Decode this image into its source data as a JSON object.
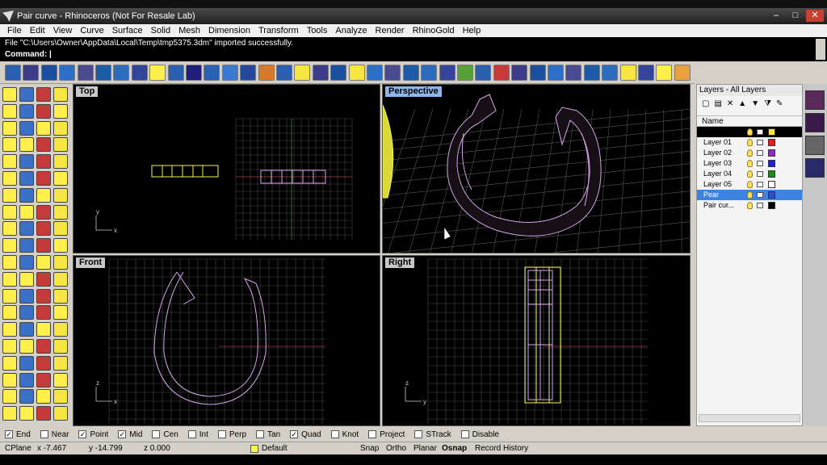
{
  "window": {
    "title": "Pair curve - Rhinoceros (Not For Resale Lab)"
  },
  "menu": [
    "File",
    "Edit",
    "View",
    "Curve",
    "Surface",
    "Solid",
    "Mesh",
    "Dimension",
    "Transform",
    "Tools",
    "Analyze",
    "Render",
    "RhinoGold",
    "Help"
  ],
  "command": {
    "history": "File \"C:\\Users\\Owner\\AppData\\Local\\Temp\\tmp5375.3dm\" imported successfully.",
    "prompt": "Command:"
  },
  "viewports": {
    "top": "Top",
    "perspective": "Perspective",
    "front": "Front",
    "right": "Right"
  },
  "axis": {
    "x": "x",
    "y": "y",
    "z": "z"
  },
  "layers": {
    "panel_title": "Layers - All Layers",
    "column_name": "Name",
    "rows": [
      {
        "name": "",
        "color": "#f5e642",
        "state": "current"
      },
      {
        "name": "Layer 01",
        "color": "#e02020",
        "state": "normal"
      },
      {
        "name": "Layer 02",
        "color": "#8a2fc0",
        "state": "normal"
      },
      {
        "name": "Layer 03",
        "color": "#2020d0",
        "state": "normal"
      },
      {
        "name": "Layer 04",
        "color": "#1a8a1a",
        "state": "normal"
      },
      {
        "name": "Layer 05",
        "color": "#ffffff",
        "state": "normal"
      },
      {
        "name": "Pear",
        "color": "#3050c8",
        "state": "selected"
      },
      {
        "name": "Pair cur...",
        "color": "#000000",
        "state": "normal"
      }
    ]
  },
  "osnap": [
    {
      "label": "End",
      "checked": true
    },
    {
      "label": "Near",
      "checked": false
    },
    {
      "label": "Point",
      "checked": true
    },
    {
      "label": "Mid",
      "checked": true
    },
    {
      "label": "Cen",
      "checked": false
    },
    {
      "label": "Int",
      "checked": false
    },
    {
      "label": "Perp",
      "checked": false
    },
    {
      "label": "Tan",
      "checked": false
    },
    {
      "label": "Quad",
      "checked": true
    },
    {
      "label": "Knot",
      "checked": false
    },
    {
      "label": "Project",
      "checked": false
    },
    {
      "label": "STrack",
      "checked": false
    },
    {
      "label": "Disable",
      "checked": false
    }
  ],
  "status": {
    "cplane": "CPlane",
    "x": "x -7.467",
    "y": "y -14.799",
    "z": "z 0.000",
    "layer": "Default",
    "snap": "Snap",
    "ortho": "Ortho",
    "planar": "Planar",
    "osnap": "Osnap",
    "record": "Record History"
  }
}
